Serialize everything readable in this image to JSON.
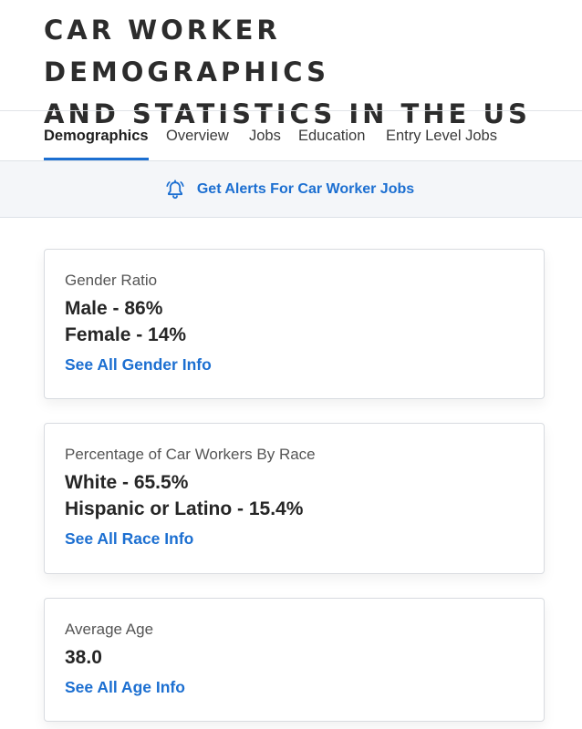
{
  "page": {
    "title_line1": "CAR WORKER DEMOGRAPHICS",
    "title_line2": "AND STATISTICS IN THE US"
  },
  "tabs": [
    {
      "label": "Demographics",
      "active": true
    },
    {
      "label": "Overview",
      "active": false
    },
    {
      "label": "Jobs",
      "active": false
    },
    {
      "label": "Education",
      "active": false
    },
    {
      "label": "Entry Level Jobs",
      "active": false
    }
  ],
  "alert": {
    "label": "Get Alerts For Car Worker Jobs",
    "icon": "bell-icon"
  },
  "cards": {
    "gender": {
      "label": "Gender Ratio",
      "stats": [
        "Male - 86%",
        "Female - 14%"
      ],
      "link": "See All Gender Info"
    },
    "race": {
      "label": "Percentage of Car Workers By Race",
      "stats": [
        "White - 65.5%",
        "Hispanic or Latino - 15.4%"
      ],
      "link": "See All Race Info"
    },
    "age": {
      "label": "Average Age",
      "stats": [
        "38.0"
      ],
      "link": "See All Age Info"
    }
  },
  "colors": {
    "accent": "#1c6fd1",
    "alert_background": "#f4f6f9",
    "title": "#2c2c2c"
  }
}
